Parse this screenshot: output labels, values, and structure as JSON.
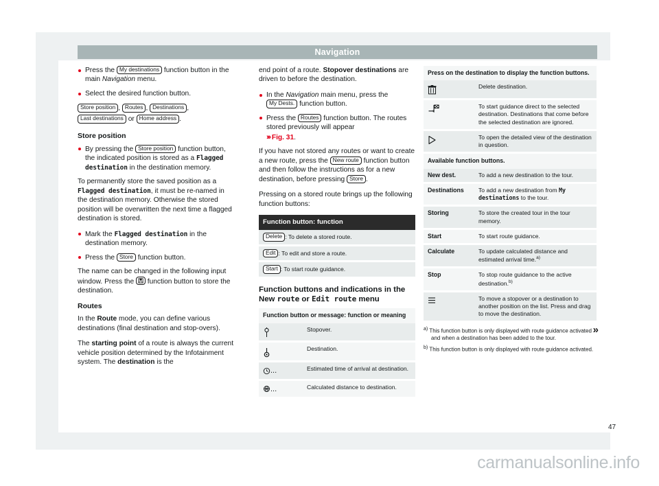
{
  "header": {
    "title": "Navigation"
  },
  "page_number": "47",
  "watermark": "carmanualsonline.info",
  "column1": {
    "b1_pre": "Press the ",
    "b1_btn": "My destinations",
    "b1_post": " function button in the main ",
    "b1_italic": "Navigation",
    "b1_end": " menu.",
    "b2_text": "Select the desired function button.",
    "b2_buttons": [
      "Store position",
      "Routes",
      "Destinations",
      "Last destinations",
      "Home address"
    ],
    "b2_or": "or",
    "heading_store_position": "Store position",
    "b3_pre": "By pressing the ",
    "b3_btn": "Store position",
    "b3_mid": " function button, the indicated position is stored as a ",
    "b3_mono": "Flagged destination",
    "b3_end": " in the destination memory.",
    "p1_pre": "To permanently store the saved position as a ",
    "p1_mono": "Flagged destination",
    "p1_end": ", it must be re-named in the destination memory. Otherwise the stored position will be overwritten the next time a flagged destination is stored.",
    "b4_pre": "Mark the ",
    "b4_mono": "Flagged destination",
    "b4_end": " in the destination memory.",
    "b5_pre": "Press the ",
    "b5_btn": "Store",
    "b5_end": " function button.",
    "p2_pre": "The name can be changed in the following input window. Press the ",
    "p2_icon": "store-disk-icon",
    "p2_end": " function button to store the destination.",
    "heading_routes": "Routes",
    "p3_pre": "In the ",
    "p3_bold": "Route",
    "p3_end": " mode, you can define various destinations (final destination and stop-overs).",
    "p4_pre": "The ",
    "p4_bold1": "starting point",
    "p4_mid": " of a route is always the current vehicle position determined by the Infotainment system. The ",
    "p4_bold2": "destination",
    "p4_end": " is the"
  },
  "column2": {
    "p1_pre": "end point of a route. ",
    "p1_bold": "Stopover destinations",
    "p1_end": " are driven to before the destination.",
    "b1_pre": "In the ",
    "b1_italic": "Navigation",
    "b1_mid": " main menu, press the ",
    "b1_btn": "My Dests.",
    "b1_end": " function button.",
    "b2_pre": "Press the ",
    "b2_btn": "Routes",
    "b2_mid": " function button. The routes stored previously will appear ",
    "b2_chev": "›››",
    "b2_fig": "Fig. 31",
    "b2_end": ".",
    "p2_pre": "If you have not stored any routes or want to create a new route, press the ",
    "p2_btn1": "New route",
    "p2_mid": " function button and then follow the instructions as for a new destination, before pressing ",
    "p2_btn2": "Store",
    "p2_end": ".",
    "p3": "Pressing on a stored route brings up the following function buttons:",
    "table1": {
      "header": "Function button: function",
      "rows": [
        {
          "button": "Delete",
          "text": ": To delete a stored route."
        },
        {
          "button": "Edit",
          "text": ": To edit and store a route."
        },
        {
          "button": "Start",
          "text": ": To start route guidance."
        }
      ]
    },
    "heading2_a": "Function buttons and indications in the New",
    "heading2_b1": "route",
    "heading2_or": " or ",
    "heading2_b2": "Edit route",
    "heading2_b3": " menu",
    "table2": {
      "header": "Function button or message: function or meaning",
      "rows": [
        {
          "icon": "stopover-pin-icon",
          "text": "Stopover."
        },
        {
          "icon": "destination-pin-icon",
          "text": "Destination."
        },
        {
          "icon": "clock-icon",
          "text": "Estimated time of arrival at destination."
        },
        {
          "icon": "distance-globe-icon",
          "text": "Calculated distance to destination."
        }
      ]
    }
  },
  "column3": {
    "table": {
      "header1": "Press on the destination to display the function buttons.",
      "rows1": [
        {
          "icon": "trash-icon",
          "text": "Delete destination."
        },
        {
          "icon": "checkered-flag-icon",
          "text": "To start guidance direct to the selected destination. Destinations that come before the selected destination are ignored."
        },
        {
          "icon": "play-triangle-icon",
          "text": "To open the detailed view of the destination in question."
        }
      ],
      "header2": "Available function buttons.",
      "rows2": [
        {
          "key": "New dest.",
          "text": "To add a new destination to the tour."
        },
        {
          "key": "Destinations",
          "text_pre": "To add a new destination from ",
          "text_mono": "My destinations",
          "text_post": " to the tour."
        },
        {
          "key": "Storing",
          "text": "To store the created tour in the tour memory."
        },
        {
          "key": "Start",
          "text": "To start route guidance."
        },
        {
          "key": "Calculate",
          "text": "To update calculated distance and estimated arrival time.",
          "sup": "a)"
        },
        {
          "key": "Stop",
          "text": "To stop route guidance to the active destination.",
          "sup": "b)"
        },
        {
          "icon": "drag-handle-icon",
          "text": "To move a stopover or a destination to another position on the list. Press and drag to move the destination."
        }
      ]
    },
    "footnotes": [
      {
        "marker": "a)",
        "text": "This function button is only displayed with route guidance activated and when a destination has been added to the tour."
      },
      {
        "marker": "b)",
        "text": "This function button is only displayed with route guidance activated."
      }
    ],
    "continue_marker": "»"
  }
}
